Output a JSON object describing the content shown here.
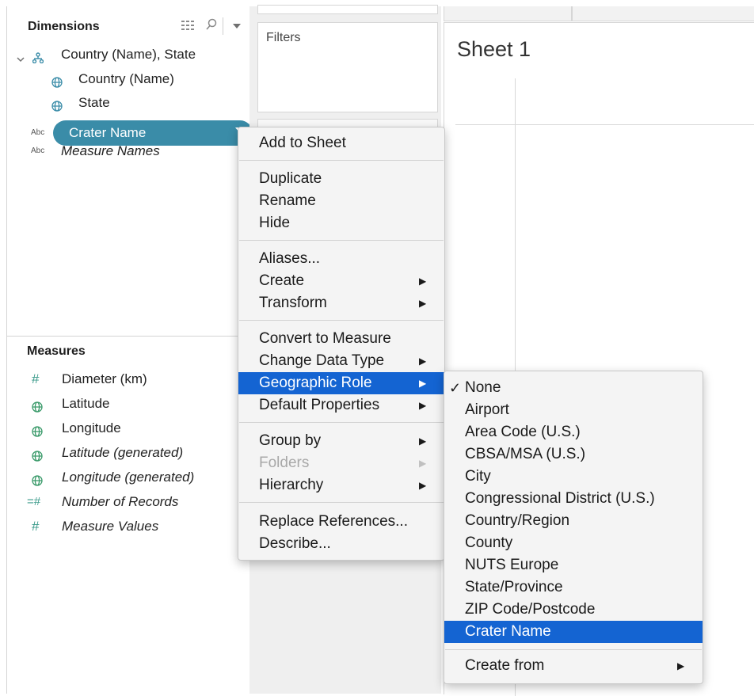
{
  "data_pane": {
    "dimensions_title": "Dimensions",
    "dimension_items": [
      {
        "label": "Country (Name), State",
        "icon": "hierarchy-icon"
      },
      {
        "label": "Country (Name)",
        "icon": "globe-icon"
      },
      {
        "label": "State",
        "icon": "globe-icon"
      },
      {
        "label": "Crater Name",
        "icon": "abc-icon",
        "icon_text": "Abc"
      },
      {
        "label": "Measure Names",
        "icon": "abc-icon",
        "icon_text": "Abc"
      }
    ],
    "measures_title": "Measures",
    "measure_items": [
      {
        "label": "Diameter (km)",
        "icon": "number-icon",
        "icon_text": "#"
      },
      {
        "label": "Latitude",
        "icon": "globe-icon"
      },
      {
        "label": "Longitude",
        "icon": "globe-icon"
      },
      {
        "label": "Latitude (generated)",
        "icon": "globe-icon"
      },
      {
        "label": "Longitude (generated)",
        "icon": "globe-icon"
      },
      {
        "label": "Number of Records",
        "icon": "number-icon",
        "icon_text": "=#"
      },
      {
        "label": "Measure Values",
        "icon": "number-icon",
        "icon_text": "#"
      }
    ]
  },
  "shelves": {
    "filters_title": "Filters"
  },
  "sheet": {
    "title": "Sheet 1"
  },
  "context_menu": {
    "items": [
      "Add to Sheet",
      "Duplicate",
      "Rename",
      "Hide",
      "Aliases...",
      "Create",
      "Transform",
      "Convert to Measure",
      "Change Data Type",
      "Geographic Role",
      "Default Properties",
      "Group by",
      "Folders",
      "Hierarchy",
      "Replace References...",
      "Describe..."
    ]
  },
  "geo_submenu": {
    "checkmark": "✓",
    "items": [
      "None",
      "Airport",
      "Area Code (U.S.)",
      "CBSA/MSA (U.S.)",
      "City",
      "Congressional District (U.S.)",
      "Country/Region",
      "County",
      "NUTS Europe",
      "State/Province",
      "ZIP Code/Postcode",
      "Crater Name",
      "Create from"
    ],
    "selected": "None",
    "highlighted": "Crater Name"
  },
  "colors": {
    "highlight": "#1464d2",
    "pill": "#3a8ca8",
    "icon_teal": "#3a9a8a"
  }
}
